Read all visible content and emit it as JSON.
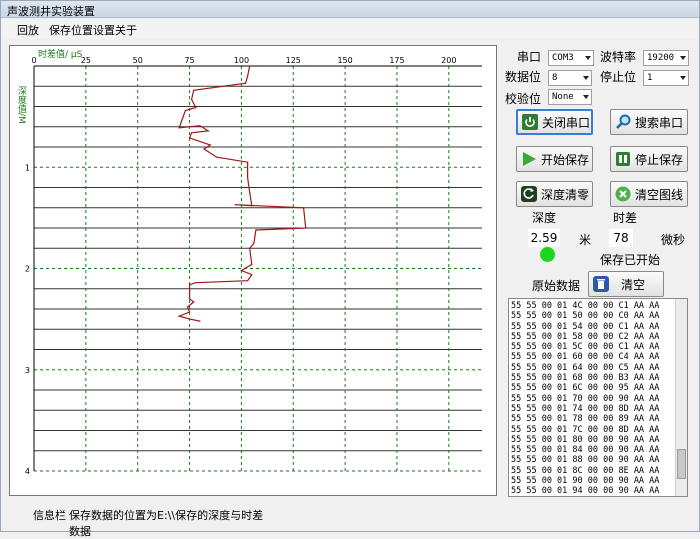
{
  "window": {
    "title": "声波测井实验装置"
  },
  "menu": [
    "回放",
    "保存位置设置",
    "关于"
  ],
  "plot": {
    "x_axis_label": "时差值/ μS",
    "y_axis_label": "深度值/M",
    "x_ticks": [
      "0",
      "25",
      "50",
      "75",
      "100",
      "125",
      "150",
      "175",
      "200"
    ],
    "y_ticks": [
      "0",
      "1",
      "2",
      "3",
      "4"
    ]
  },
  "chart_data": {
    "type": "line",
    "xlim": [
      0,
      216
    ],
    "ylim": [
      0,
      4
    ],
    "series_color": "#a01818",
    "points": [
      [
        104,
        0.0
      ],
      [
        103,
        0.1
      ],
      [
        102,
        0.17
      ],
      [
        77,
        0.24
      ],
      [
        76,
        0.33
      ],
      [
        78,
        0.41
      ],
      [
        73,
        0.44
      ],
      [
        70,
        0.61
      ],
      [
        80,
        0.59
      ],
      [
        84,
        0.64
      ],
      [
        76,
        0.66
      ],
      [
        75,
        0.71
      ],
      [
        85,
        0.78
      ],
      [
        82,
        0.82
      ],
      [
        88,
        0.9
      ],
      [
        103,
        0.95
      ],
      [
        103,
        1.1
      ],
      [
        104,
        1.25
      ],
      [
        105,
        1.38
      ],
      [
        97,
        1.37
      ],
      [
        130,
        1.4
      ],
      [
        131,
        1.6
      ],
      [
        107,
        1.62
      ],
      [
        106,
        1.75
      ],
      [
        104,
        1.8
      ],
      [
        105,
        1.96
      ],
      [
        100,
        2.02
      ],
      [
        105,
        2.06
      ],
      [
        103,
        2.12
      ],
      [
        78,
        2.14
      ],
      [
        75,
        2.16
      ],
      [
        75,
        2.3
      ],
      [
        77,
        2.33
      ],
      [
        74,
        2.38
      ],
      [
        75,
        2.43
      ],
      [
        70,
        2.47
      ],
      [
        75,
        2.5
      ],
      [
        80,
        2.52
      ]
    ]
  },
  "serial": {
    "port_label": "串口",
    "port_value": "COM3",
    "baud_label": "波特率",
    "baud_value": "19200",
    "databits_label": "数据位",
    "databits_value": "8",
    "stopbits_label": "停止位",
    "stopbits_value": "1",
    "parity_label": "校验位",
    "parity_value": "None"
  },
  "buttons": {
    "close_port": "关闭串口",
    "search_port": "搜索串口",
    "start_save": "开始保存",
    "stop_save": "停止保存",
    "reset_depth": "深度清零",
    "clear_plot": "清空图线",
    "clear_raw": "清空"
  },
  "readouts": {
    "depth_label": "深度",
    "depth_value": "2.59",
    "depth_unit": "米",
    "delay_label": "时差",
    "delay_value": "78",
    "delay_unit": "微秒",
    "save_status": "保存已开始",
    "raw_label": "原始数据"
  },
  "raw_data": [
    "55 55 00 01 4C 00 00 C1 AA AA",
    "55 55 00 01 50 00 00 C0 AA AA",
    "55 55 00 01 54 00 00 C1 AA AA",
    "55 55 00 01 58 00 00 C2 AA AA",
    "55 55 00 01 5C 00 00 C1 AA AA",
    "55 55 00 01 60 00 00 C4 AA AA",
    "55 55 00 01 64 00 00 C5 AA AA",
    "55 55 00 01 68 00 00 B3 AA AA",
    "55 55 00 01 6C 00 00 95 AA AA",
    "55 55 00 01 70 00 00 90 AA AA",
    "55 55 00 01 74 00 00 8D AA AA",
    "55 55 00 01 78 00 00 89 AA AA",
    "55 55 00 01 7C 00 00 8D AA AA",
    "55 55 00 01 80 00 00 90 AA AA",
    "55 55 00 01 84 00 00 90 AA AA",
    "55 55 00 01 88 00 00 90 AA AA",
    "55 55 00 01 8C 00 00 8E AA AA",
    "55 55 00 01 90 00 00 90 AA AA",
    "55 55 00 01 94 00 00 90 AA AA"
  ],
  "status": {
    "label": "信息栏",
    "message": "保存数据的位置为E:\\\\保存的深度与时差数据"
  }
}
